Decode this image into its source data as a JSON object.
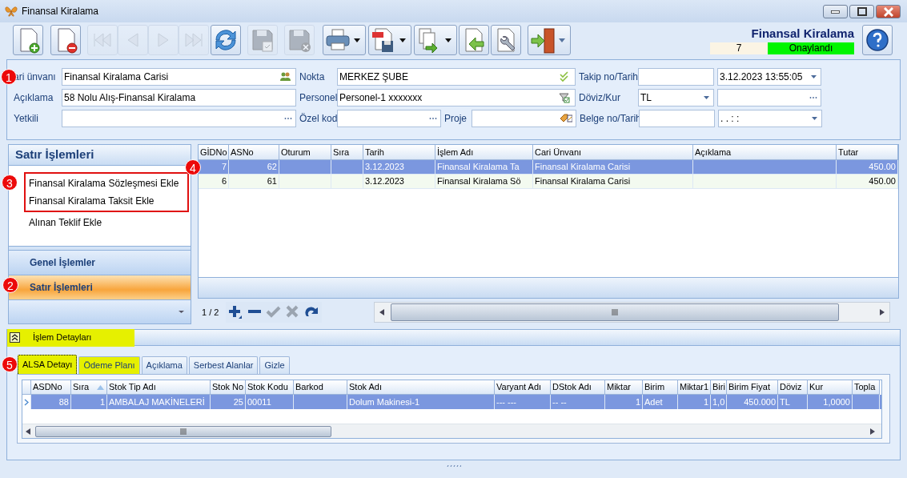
{
  "window": {
    "title": "Finansal Kiralama"
  },
  "toolbar": [
    {
      "disabled": false,
      "dropdown": false
    },
    {
      "disabled": false,
      "dropdown": false
    },
    {
      "disabled": true,
      "dropdown": false
    },
    {
      "disabled": true,
      "dropdown": false
    },
    {
      "disabled": true,
      "dropdown": false
    },
    {
      "disabled": true,
      "dropdown": false
    },
    {
      "disabled": false,
      "dropdown": false
    },
    {
      "disabled": true,
      "dropdown": false
    },
    {
      "disabled": true,
      "dropdown": false
    },
    {
      "disabled": false,
      "dropdown": true
    },
    {
      "disabled": false,
      "dropdown": true
    },
    {
      "disabled": false,
      "dropdown": true
    },
    {
      "disabled": false,
      "dropdown": false
    },
    {
      "disabled": false,
      "dropdown": false
    },
    {
      "disabled": false,
      "dropdown": true
    }
  ],
  "record": {
    "title": "Finansal Kiralama",
    "number": "7",
    "status": "Onaylandı"
  },
  "form": [
    [
      {
        "kind": "label",
        "text": "ari ünvanı"
      },
      {
        "kind": "people",
        "value": "Finansal Kiralama Carisi"
      },
      {
        "kind": "label",
        "text": "Nokta"
      },
      {
        "kind": "check",
        "value": "MERKEZ ŞUBE"
      },
      {
        "kind": "label",
        "text": "Takip no/Tarih"
      },
      {
        "kind": "text"
      },
      {
        "kind": "dropdown",
        "value": "3.12.2023 13:55:05"
      }
    ],
    [
      {
        "kind": "label",
        "text": "Açıklama"
      },
      {
        "kind": "text",
        "value": "58 Nolu Alış-Finansal Kiralama"
      },
      {
        "kind": "label",
        "text": "Personel"
      },
      {
        "kind": "filter",
        "value": "Personel-1 xxxxxxx"
      },
      {
        "kind": "label",
        "text": "Döviz/Kur"
      },
      {
        "kind": "dropdown",
        "value": "TL"
      },
      {
        "kind": "ellipsis"
      }
    ],
    [
      {
        "kind": "label",
        "text": "Yetkili"
      },
      {
        "kind": "ellipsis"
      },
      {
        "kind": "label",
        "text": "Özel kod"
      },
      {
        "kind": "ellipsis"
      },
      {
        "kind": "label",
        "text": "Proje"
      },
      {
        "kind": "tags"
      },
      {
        "kind": "label",
        "text": "Belge no/Tarih"
      },
      {
        "kind": "text"
      },
      {
        "kind": "dropdown",
        "value": ".  .      :  :"
      }
    ]
  ],
  "sidebar": {
    "title": "Satır İşlemleri",
    "items": [
      {
        "label": "Finansal Kiralama Sözleşmesi Ekle",
        "highlighted": true
      },
      {
        "label": "Finansal Kiralama Taksit Ekle",
        "highlighted": true
      },
      {
        "label": "Alınan Teklif Ekle",
        "highlighted": false
      }
    ],
    "groups": [
      {
        "label": "Genel İşlemler",
        "selected": false
      },
      {
        "label": "Satır İşlemleri",
        "selected": true
      }
    ]
  },
  "main_grid": {
    "columns": [
      {
        "label": "GİDNo",
        "kind": "number"
      },
      {
        "label": "ASNo",
        "kind": "number"
      },
      {
        "label": "Oturum",
        "kind": "text"
      },
      {
        "label": "Sıra",
        "kind": "text"
      },
      {
        "label": "Tarih",
        "kind": "text"
      },
      {
        "label": "İşlem Adı",
        "kind": "text"
      },
      {
        "label": "Cari Ünvanı",
        "kind": "text"
      },
      {
        "label": "Açıklama",
        "kind": "text"
      },
      {
        "label": "Tutar",
        "kind": "number"
      }
    ],
    "rows": [
      {
        "selected": true,
        "cells": [
          "7",
          "62",
          "",
          "",
          "3.12.2023",
          "Finansal Kiralama Ta",
          "Finansal Kiralama Carisi",
          "",
          "450.00"
        ]
      },
      {
        "selected": false,
        "cells": [
          "6",
          "61",
          "",
          "",
          "3.12.2023",
          "Finansal Kiralama Sö",
          "Finansal Kiralama Carisi",
          "",
          "450.00"
        ]
      }
    ],
    "position": "1 / 2"
  },
  "details": {
    "title": "İşlem Detayları",
    "highlighted": true,
    "tabs": [
      {
        "label": "ALSA Detayı",
        "selected": true,
        "highlighted": true
      },
      {
        "label": "Ödeme Planı",
        "selected": false,
        "highlighted": true
      },
      {
        "label": "Açıklama",
        "selected": false,
        "highlighted": false
      },
      {
        "label": "Serbest Alanlar",
        "selected": false,
        "highlighted": false
      },
      {
        "label": "Gizle",
        "selected": false,
        "highlighted": false
      }
    ],
    "grid": {
      "columns": [
        {
          "label": "ASDNo",
          "kind": "number"
        },
        {
          "label": "Sıra",
          "kind": "number",
          "sorted": true
        },
        {
          "label": "Stok Tip Adı",
          "kind": "text"
        },
        {
          "label": "Stok No",
          "kind": "number"
        },
        {
          "label": "Stok Kodu",
          "kind": "text"
        },
        {
          "label": "Barkod",
          "kind": "text"
        },
        {
          "label": "Stok Adı",
          "kind": "text"
        },
        {
          "label": "Varyant Adı",
          "kind": "text"
        },
        {
          "label": "DStok Adı",
          "kind": "text"
        },
        {
          "label": "Miktar",
          "kind": "number"
        },
        {
          "label": "Birim",
          "kind": "text"
        },
        {
          "label": "Miktar1",
          "kind": "number"
        },
        {
          "label": "Biri",
          "kind": "text"
        },
        {
          "label": "Birim Fiyat",
          "kind": "number"
        },
        {
          "label": "Döviz",
          "kind": "text"
        },
        {
          "label": "Kur",
          "kind": "number"
        },
        {
          "label": "Topla",
          "kind": "text"
        }
      ],
      "rows": [
        {
          "selected": true,
          "cells": [
            "88",
            "1",
            "AMBALAJ MAKİNELERİ",
            "25",
            "00011",
            "",
            "Dolum Makinesi-1",
            "--- ---",
            "-- --",
            "1",
            "Adet",
            "1",
            "1,0",
            "450.000",
            "TL",
            "1,0000",
            ""
          ]
        }
      ]
    }
  },
  "markers": [
    {
      "label": "1"
    },
    {
      "label": "4"
    },
    {
      "label": "3"
    },
    {
      "label": "2"
    },
    {
      "label": "5"
    }
  ]
}
